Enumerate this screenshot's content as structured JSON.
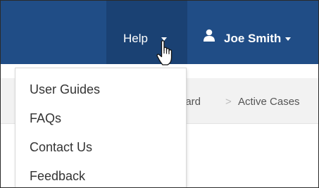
{
  "navbar": {
    "help_label": "Help",
    "user_name": "Joe Smith"
  },
  "help_menu": {
    "items": [
      {
        "label": "User Guides"
      },
      {
        "label": "FAQs"
      },
      {
        "label": "Contact Us"
      },
      {
        "label": "Feedback"
      }
    ]
  },
  "breadcrumb": {
    "parent_partial": "oard",
    "separator": ">",
    "current": "Active Cases"
  },
  "icons": {
    "user": "user-icon",
    "caret": "caret-down-icon",
    "cursor": "hand-pointer-cursor"
  },
  "colors": {
    "navbar": "#204d86",
    "navbar_active": "#1a4173",
    "nav_text": "#ffffff",
    "menu_text": "#333333",
    "breadcrumb_bg": "#f2f2f2"
  }
}
